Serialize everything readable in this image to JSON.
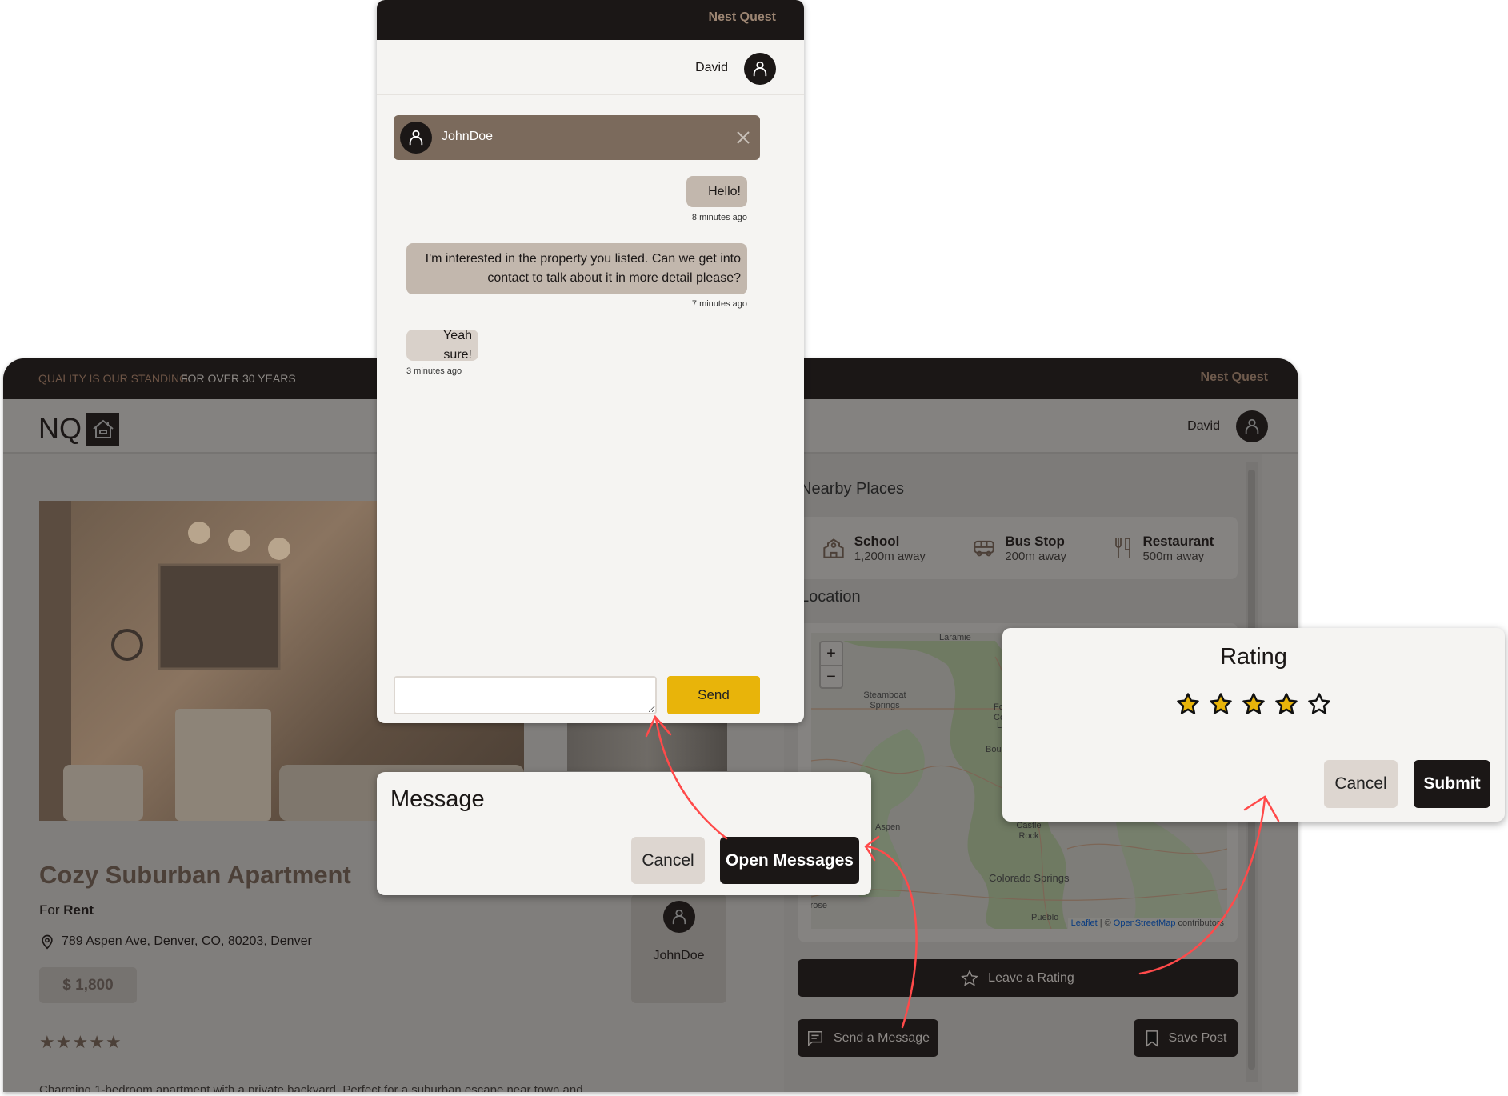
{
  "app": {
    "tagline_muted": "QUALITY IS OUR STANDING",
    "tagline_bold": "FOR OVER 30 YEARS",
    "brand": "Nest Quest",
    "logo_text": "NQ",
    "user_name": "David",
    "listing": {
      "title": "Cozy Suburban Apartment",
      "for_prefix": "For",
      "for_type": "Rent",
      "address": "789 Aspen Ave, Denver, CO, 80203, Denver",
      "price": "$ 1,800",
      "rating": 5,
      "description": "Charming 1-bedroom apartment with a private backyard. Perfect for a suburban escape near town and"
    },
    "owner": {
      "name": "JohnDoe"
    },
    "nearby": {
      "title": "Nearby Places",
      "items": [
        {
          "icon": "school-icon",
          "name": "School",
          "distance": "1,200m away"
        },
        {
          "icon": "bus-icon",
          "name": "Bus Stop",
          "distance": "200m away"
        },
        {
          "icon": "restaurant-icon",
          "name": "Restaurant",
          "distance": "500m away"
        }
      ]
    },
    "location": {
      "title": "Location",
      "map_labels": [
        "Laramie",
        "Steamboat Springs",
        "Fort Collins",
        "Loveland",
        "Boulder",
        "Aspen",
        "Castle Rock",
        "Colorado Springs",
        "Pueblo",
        "Montrose"
      ],
      "zoom_in": "+",
      "zoom_out": "−",
      "attribution_leaflet": "Leaflet",
      "attribution_sep": "| ©",
      "attribution_osm": "OpenStreetMap",
      "attribution_tail": "contributors"
    },
    "actions": {
      "rate": "Leave a Rating",
      "message": "Send a Message",
      "save": "Save Post"
    }
  },
  "chat": {
    "brand": "Nest Quest",
    "user_name": "David",
    "contact": "JohnDoe",
    "messages": [
      {
        "text": "Hello!",
        "time": "8 minutes ago",
        "side": "right"
      },
      {
        "text": "I'm interested in the property you listed. Can we get into contact to talk about it in more detail please?",
        "time": "7 minutes ago",
        "side": "right"
      },
      {
        "text": "Yeah sure!",
        "time": "3 minutes ago",
        "side": "left"
      }
    ],
    "input_value": "",
    "send": "Send"
  },
  "message_dialog": {
    "title": "Message",
    "cancel": "Cancel",
    "confirm": "Open Messages"
  },
  "rating_dialog": {
    "title": "Rating",
    "value": 4,
    "max": 5,
    "cancel": "Cancel",
    "submit": "Submit"
  },
  "colors": {
    "dark": "#1b1716",
    "accent": "#e8b40a",
    "contact_bar": "#7b6a5c",
    "bubble": "#c2b7ad",
    "annotation": "#ff4a4a"
  }
}
